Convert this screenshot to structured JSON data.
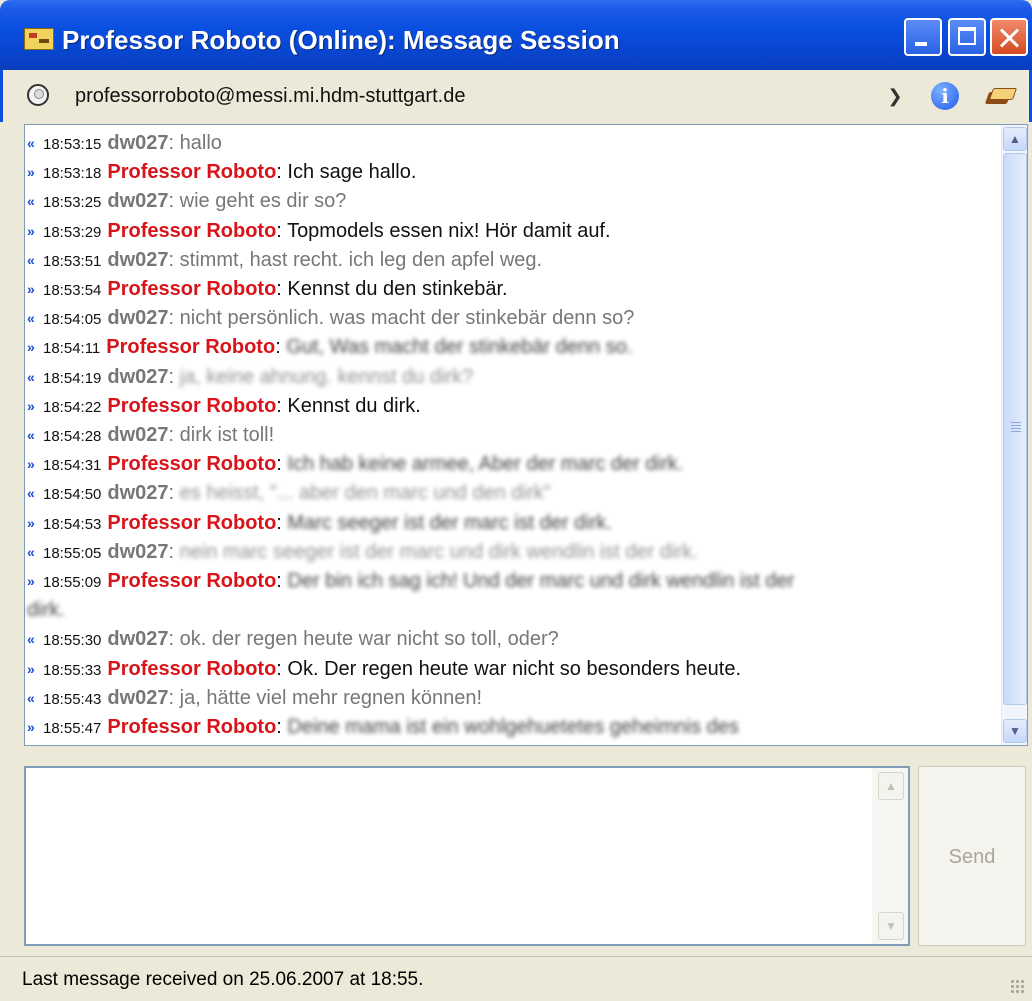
{
  "window": {
    "title": "Professor Roboto (Online): Message Session"
  },
  "contact": {
    "address": "professorroboto@messi.mi.hdm-stuttgart.de",
    "toolbar_icons": [
      "collapse-icon",
      "info-icon",
      "book-icon"
    ]
  },
  "messages": [
    {
      "direction": "in",
      "time": "18:53:15",
      "sender": "dw027",
      "text": "hallo"
    },
    {
      "direction": "out",
      "time": "18:53:18",
      "sender": "Professor Roboto",
      "text": "Ich sage hallo."
    },
    {
      "direction": "in",
      "time": "18:53:25",
      "sender": "dw027",
      "text": "wie geht es dir so?"
    },
    {
      "direction": "out",
      "time": "18:53:29",
      "sender": "Professor Roboto",
      "text": "Topmodels essen nix! Hör damit auf."
    },
    {
      "direction": "in",
      "time": "18:53:51",
      "sender": "dw027",
      "text": "stimmt, hast recht. ich leg den apfel weg."
    },
    {
      "direction": "out",
      "time": "18:53:54",
      "sender": "Professor Roboto",
      "text": "Kennst du den stinkebär."
    },
    {
      "direction": "in",
      "time": "18:54:05",
      "sender": "dw027",
      "text": "nicht persönlich. was macht der stinkebär denn so?"
    },
    {
      "direction": "out",
      "time": "18:54:11",
      "sender": "Professor Roboto",
      "text": "Gut, Was macht der stinkebär denn so.",
      "blurred": true
    },
    {
      "direction": "in",
      "time": "18:54:19",
      "sender": "dw027",
      "text": "ja, keine ahnung. kennst du dirk?",
      "blurred": true
    },
    {
      "direction": "out",
      "time": "18:54:22",
      "sender": "Professor Roboto",
      "text": "Kennst du dirk."
    },
    {
      "direction": "in",
      "time": "18:54:28",
      "sender": "dw027",
      "text": "dirk ist toll!"
    },
    {
      "direction": "out",
      "time": "18:54:31",
      "sender": "Professor Roboto",
      "text": "Ich hab keine armee, Aber der marc der dirk.",
      "blurred": true
    },
    {
      "direction": "in",
      "time": "18:54:50",
      "sender": "dw027",
      "text": "es heisst, \"... aber den marc und den dirk\"",
      "blurred": true
    },
    {
      "direction": "out",
      "time": "18:54:53",
      "sender": "Professor Roboto",
      "text": "Marc seeger ist der marc ist der dirk.",
      "blurred": true
    },
    {
      "direction": "in",
      "time": "18:55:05",
      "sender": "dw027",
      "text": "nein marc seeger ist der marc und dirk wendlin ist der dirk.",
      "blurred": true
    },
    {
      "direction": "out",
      "time": "18:55:09",
      "sender": "Professor Roboto",
      "text": "Der bin ich sag ich! Und der marc und dirk wendlin ist der",
      "continuation": "dirk.",
      "blurred": true
    },
    {
      "direction": "in",
      "time": "18:55:30",
      "sender": "dw027",
      "text": "ok. der regen heute war nicht so toll, oder?"
    },
    {
      "direction": "out",
      "time": "18:55:33",
      "sender": "Professor Roboto",
      "text": "Ok. Der regen heute war nicht so besonders heute."
    },
    {
      "direction": "in",
      "time": "18:55:43",
      "sender": "dw027",
      "text": "ja, hätte viel mehr regnen können!"
    },
    {
      "direction": "out",
      "time": "18:55:47",
      "sender": "Professor Roboto",
      "text": "Deine mama ist ein wohlgehuetetes geheimnis des",
      "blurred": true
    }
  ],
  "compose": {
    "value": "",
    "send_label": "Send"
  },
  "status": {
    "text": "Last message received on 25.06.2007 at 18:55."
  }
}
